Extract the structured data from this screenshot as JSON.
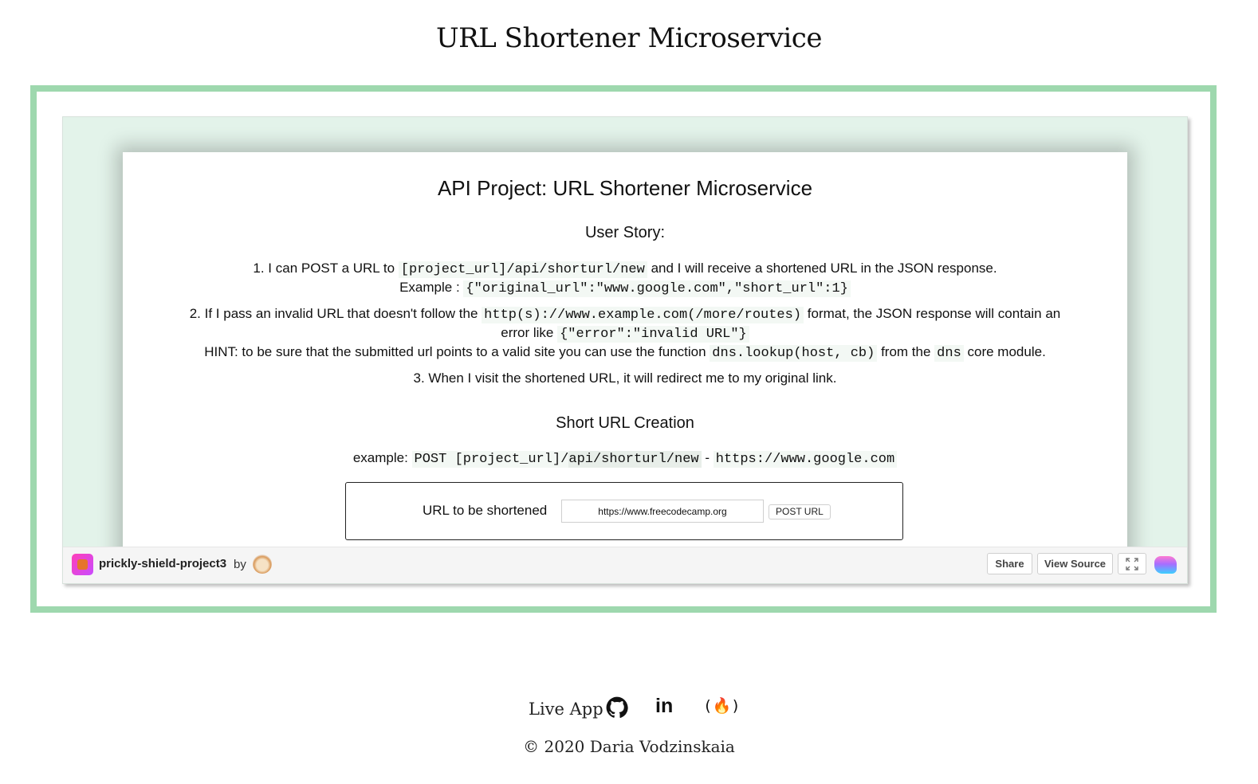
{
  "page": {
    "title": "URL Shortener Microservice",
    "copyright": "© 2020 Daria Vodzinskaia"
  },
  "links": {
    "live_app": "Live App",
    "icons": [
      "github-icon",
      "linkedin-icon",
      "freecodecamp-icon"
    ],
    "linkedin_glyph": "in",
    "fcc_glyph": "(🔥)"
  },
  "card": {
    "heading": "API Project: URL Shortener Microservice",
    "user_story_heading": "User Story:",
    "story1_prefix": "1. I can POST a URL to",
    "story1_code": "[project_url]/api/shorturl/new",
    "story1_suffix": "and I will receive a shortened URL in the JSON response.",
    "story1_example_prefix": "Example :",
    "story1_example_code": "{\"original_url\":\"www.google.com\",\"short_url\":1}",
    "story2_prefix": "2. If I pass an invalid URL that doesn't follow the",
    "story2_code": "http(s)://www.example.com(/more/routes)",
    "story2_suffix": "format, the JSON response will contain an",
    "story2_error_prefix": "error like",
    "story2_error_code": "{\"error\":\"invalid URL\"}",
    "hint_prefix": "HINT: to be sure that the submitted url points to a valid site you can use the function",
    "hint_code": "dns.lookup(host, cb)",
    "hint_mid": "from the",
    "hint_code2": "dns",
    "hint_suffix": "core module.",
    "story3": "3. When I visit the shortened URL, it will redirect me to my original link.",
    "creation_heading": "Short URL Creation",
    "example_prefix": "example:",
    "example_code_a": "POST [project_url]/",
    "example_code_b": "api/shorturl/new",
    "example_dash": "-",
    "example_code_c": "https://www.google.com",
    "form_label": "URL to be shortened",
    "input_value": "https://www.freecodecamp.org",
    "post_button": "POST URL"
  },
  "embed_footer": {
    "project_name": "prickly-shield-project3",
    "by": "by",
    "share": "Share",
    "view_source": "View Source",
    "fullscreen_icon": "fullscreen-icon",
    "glitch_logo": "glitch-logo-icon"
  },
  "colors": {
    "frame_green": "#9ed8ae",
    "embed_bg": "#e3f3ea"
  }
}
